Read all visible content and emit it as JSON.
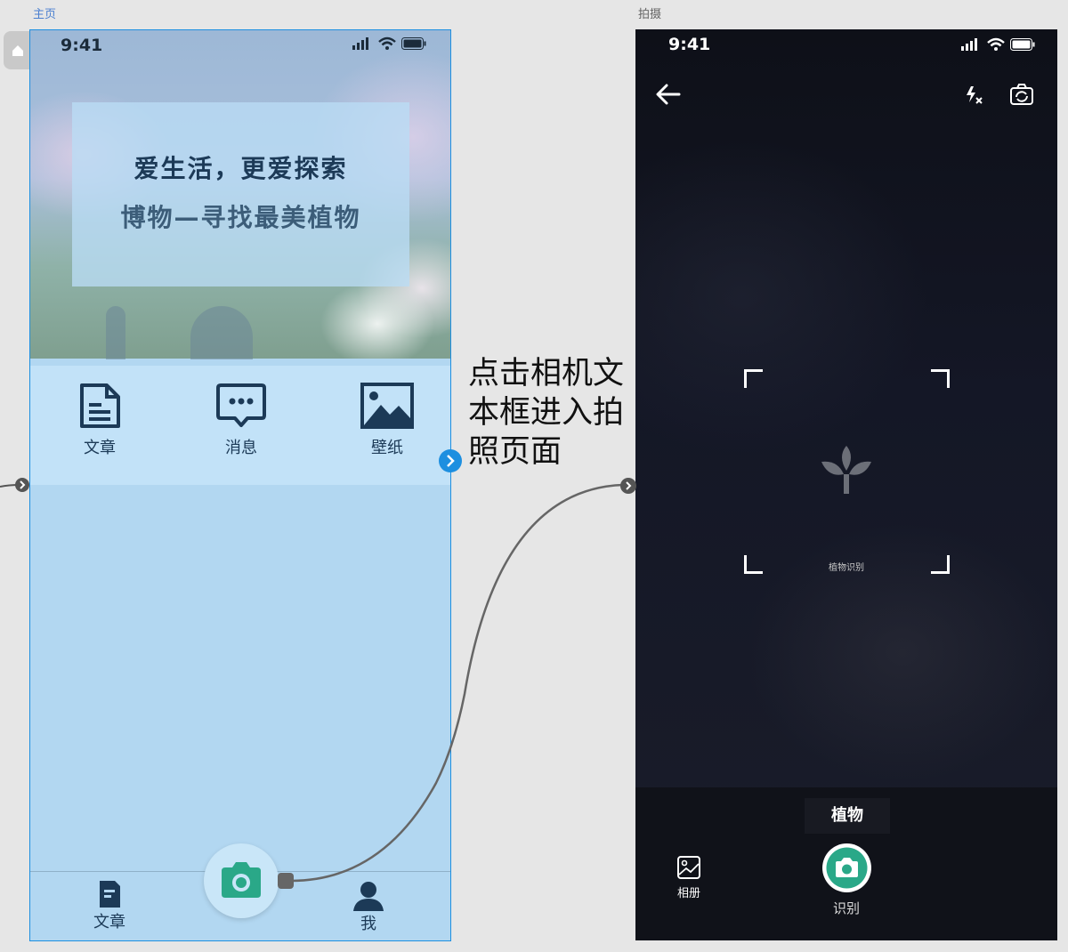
{
  "artboards": {
    "home_label": "主页",
    "camera_label": "拍摄"
  },
  "home": {
    "status_time": "9:41",
    "hero_line1": "爱生活，更爱探索",
    "hero_line2": "博物—寻找最美植物",
    "quick_items": [
      {
        "label": "文章",
        "icon": "document-icon"
      },
      {
        "label": "消息",
        "icon": "message-icon"
      },
      {
        "label": "壁纸",
        "icon": "image-icon"
      }
    ],
    "tabs": {
      "articles": "文章",
      "me": "我"
    }
  },
  "annotation": {
    "text_line1": "点击相机文",
    "text_line2": "本框进入拍",
    "text_line3": "照页面"
  },
  "camera": {
    "status_time": "9:41",
    "viewfinder_caption": "植物识别",
    "mode_label": "植物",
    "album_label": "相册",
    "shutter_label": "识别",
    "accent_color": "#2aa888"
  }
}
